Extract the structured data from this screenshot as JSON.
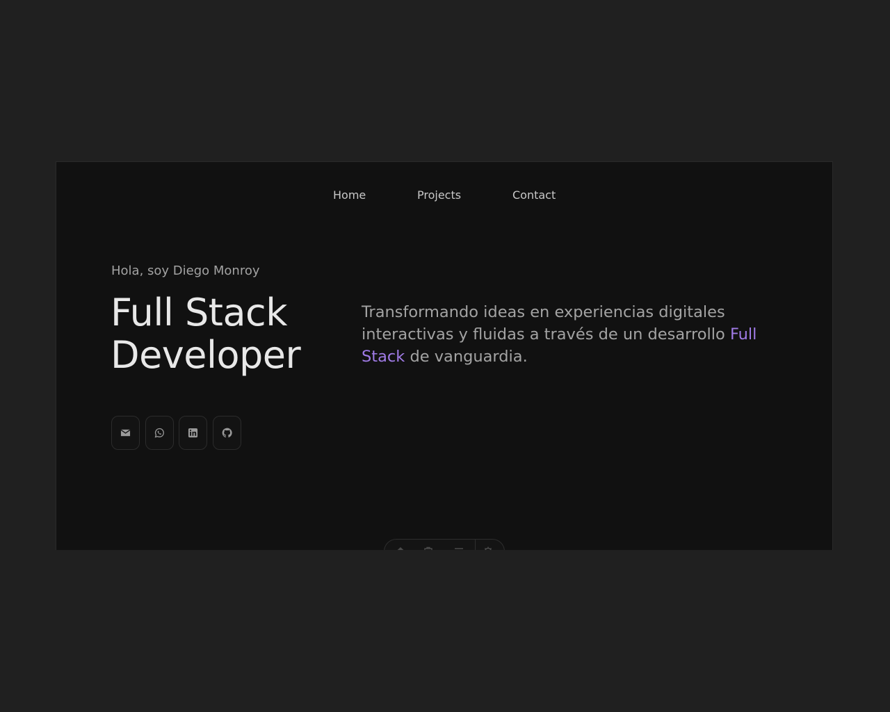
{
  "nav": {
    "items": [
      {
        "label": "Home"
      },
      {
        "label": "Projects"
      },
      {
        "label": "Contact"
      }
    ]
  },
  "hero": {
    "greeting": "Hola, soy Diego Monroy",
    "title_line1": "Full Stack",
    "title_line2": "Developer",
    "tagline_before": "Transformando ideas en experiencias digitales interactivas y fluidas a través de un desarrollo ",
    "tagline_accent": "Full Stack",
    "tagline_after": " de vanguardia."
  },
  "socials": [
    {
      "icon": "envelope-icon"
    },
    {
      "icon": "whatsapp-icon"
    },
    {
      "icon": "linkedin-icon"
    },
    {
      "icon": "github-icon"
    }
  ],
  "dock": {
    "icons": [
      "home-icon",
      "projects-icon",
      "menu-icon",
      "settings-icon"
    ]
  },
  "colors": {
    "page_background": "#202020",
    "frame_background": "#111111",
    "accent": "#a07be6",
    "title_text": "#e8e8e8",
    "muted_text": "#a3a3a3"
  }
}
